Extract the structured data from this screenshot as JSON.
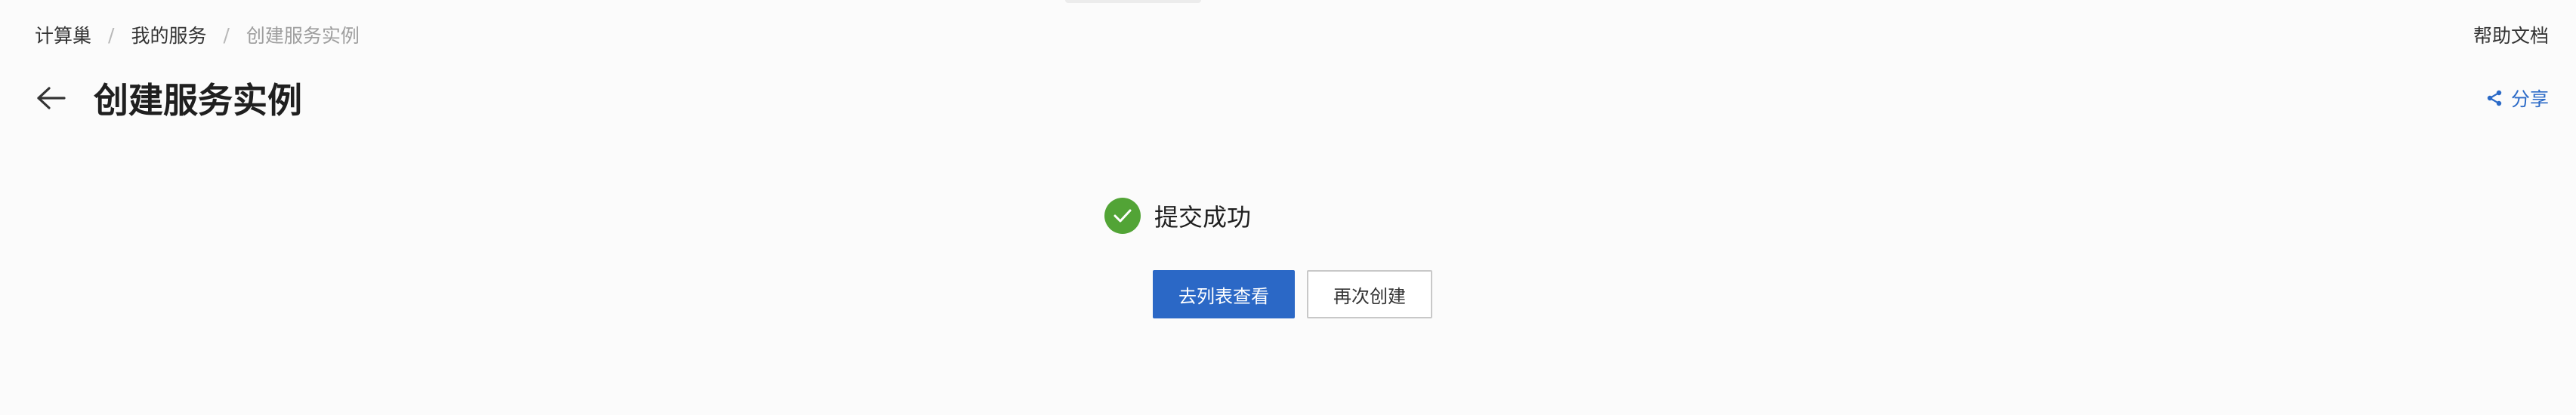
{
  "breadcrumb": {
    "items": [
      "计算巢",
      "我的服务",
      "创建服务实例"
    ],
    "separator": "/"
  },
  "header": {
    "help_label": "帮助文档",
    "title": "创建服务实例",
    "share_label": "分享"
  },
  "result": {
    "status": "success",
    "title": "提交成功",
    "primary_button": "去列表查看",
    "secondary_button": "再次创建"
  },
  "colors": {
    "accent": "#2b68c6",
    "success": "#52a436",
    "background": "#fbfbfb"
  },
  "icons": {
    "back": "arrow-left-icon",
    "share": "share-icon",
    "success": "check-circle-icon"
  }
}
